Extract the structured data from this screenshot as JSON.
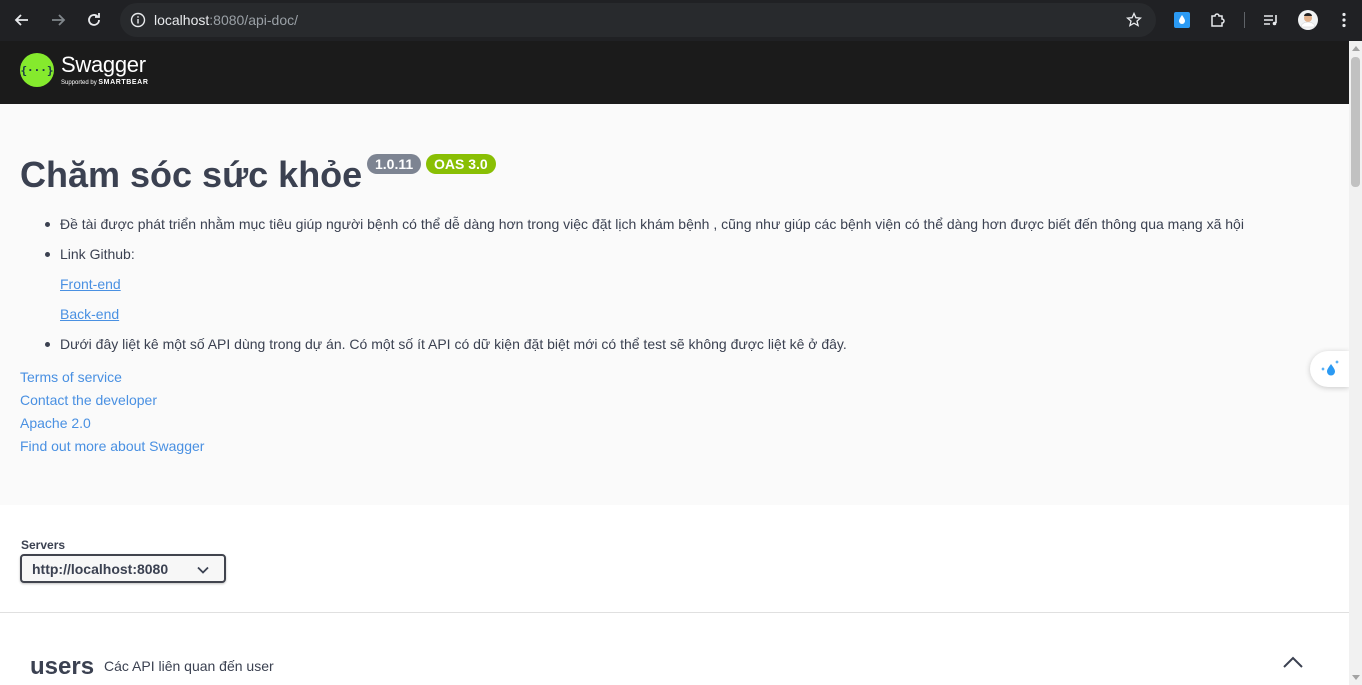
{
  "browser": {
    "url_host": "localhost",
    "url_rest": ":8080/api-doc/"
  },
  "topbar": {
    "logo_name": "Swagger",
    "logo_sub_prefix": "Supported by",
    "logo_sub_brand": "SMARTBEAR"
  },
  "info": {
    "title": "Chăm sóc sức khỏe",
    "version_badge": "1.0.11",
    "oas_badge": "OAS 3.0",
    "description": {
      "item1": "Đề tài được phát triển nhằm mục tiêu giúp người bệnh có thể dễ dàng hơn trong việc đặt lịch khám bệnh , cũng như giúp các bệnh viện có thể dàng hơn được biết đến thông qua mạng xã hội",
      "item2": "Link Github:",
      "link_frontend": "Front-end",
      "link_backend": "Back-end",
      "item5": "Dưới đây liệt kê một số API dùng trong dự án. Có một số ít API có dữ kiện đặt biệt mới có thể test sẽ không được liệt kê ở đây."
    },
    "links": {
      "terms": "Terms of service",
      "contact": "Contact the developer",
      "license": "Apache 2.0",
      "external_docs": "Find out more about Swagger"
    }
  },
  "servers": {
    "label": "Servers",
    "selected": "http://localhost:8080"
  },
  "tag": {
    "name": "users",
    "description": "Các API liên quan đến user"
  },
  "colors": {
    "swagger_green": "#85ea2d",
    "link_blue": "#4990e2",
    "text_dark": "#3b4151",
    "version_badge": "#7d8492",
    "oas_badge": "#89bf04"
  }
}
